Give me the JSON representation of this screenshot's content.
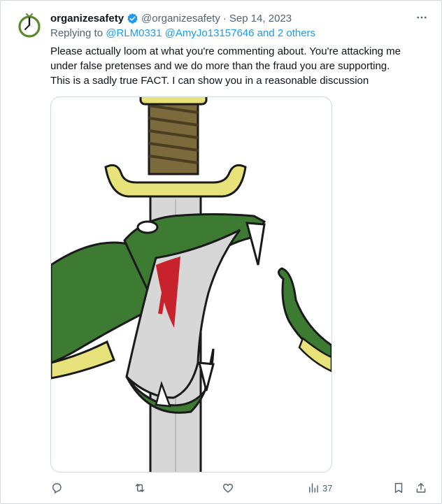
{
  "tweet": {
    "display_name": "organizesafety",
    "handle": "@organizesafety",
    "separator": "·",
    "date": "Sep 14, 2023",
    "replying_prefix": "Replying to",
    "mentions": [
      "@RLM0331",
      "@AmyJo13157646",
      "and 2 others"
    ],
    "text": "Please actually loom at what you're commenting about. You're attacking me\nunder false pretenses and we do more than the fraud you are supporting.\nThis is a sadly true FACT. I can show you in a reasonable discussion"
  },
  "actions": {
    "views_count": "37"
  },
  "colors": {
    "accent": "#1d9bf0",
    "verified": "#1d9bf0",
    "muted_text": "#536471",
    "snake_green": "#3d7a32",
    "logo_green": "#5a8a2c"
  },
  "icons": [
    "more-icon",
    "verified-badge-icon",
    "reply-icon",
    "retweet-icon",
    "like-icon",
    "views-icon",
    "bookmark-icon",
    "share-icon"
  ]
}
